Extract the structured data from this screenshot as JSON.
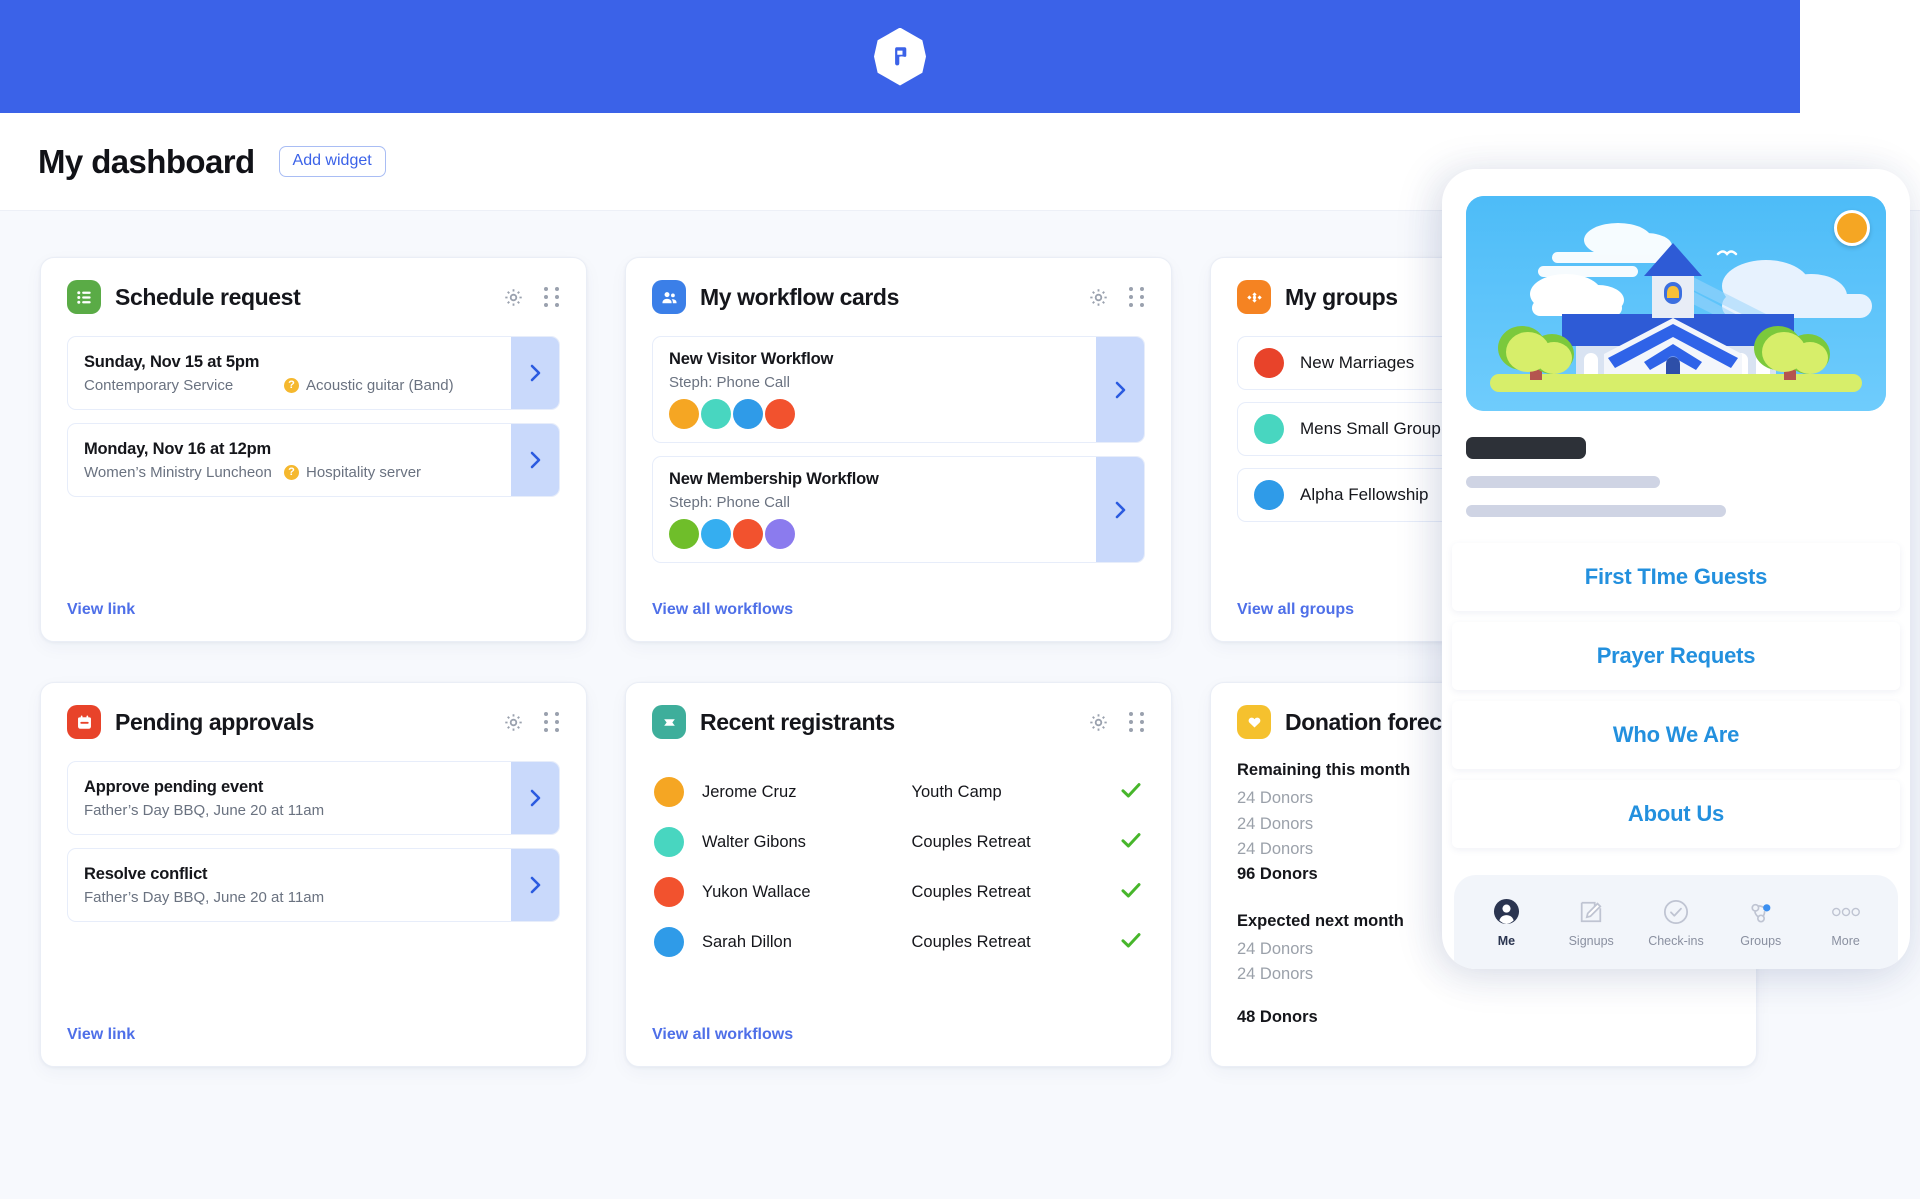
{
  "header": {
    "logo_name": "planning-center-logo",
    "bar_color": "#3B62E8"
  },
  "page": {
    "title": "My dashboard",
    "add_widget_label": "Add widget"
  },
  "widgets": [
    {
      "id": "schedule-request",
      "title": "Schedule request",
      "icon": "services-list-icon",
      "icon_color": "#5AAB46",
      "link_label": "View link",
      "items": [
        {
          "main": "Sunday, Nov 15 at 5pm",
          "sub_left": "Contemporary Service",
          "sub_right": "Acoustic guitar (Band)",
          "has_warning": true
        },
        {
          "main": "Monday, Nov 16 at 12pm",
          "sub_left": "Women’s Ministry Luncheon",
          "sub_right": "Hospitality server",
          "has_warning": true
        }
      ]
    },
    {
      "id": "my-workflow-cards",
      "title": "My workflow cards",
      "icon": "people-icon",
      "icon_color": "#3B7FE8",
      "link_label": "View all workflows",
      "items": [
        {
          "main": "New Visitor Workflow",
          "sub_left": "Steph: Phone Call",
          "avatars": [
            "#F5A623",
            "#48D6C0",
            "#2F9BE8",
            "#F2522E"
          ]
        },
        {
          "main": "New Membership Workflow",
          "sub_left": "Steph: Phone Call",
          "avatars": [
            "#6FBE2A",
            "#35AEF0",
            "#F2522E",
            "#8B7BEE"
          ]
        }
      ]
    },
    {
      "id": "my-groups",
      "title": "My groups",
      "icon": "groups-icon",
      "icon_color": "#F58322",
      "link_label": "View all groups",
      "groups": [
        {
          "name": "New Marriages",
          "avatar_color": "#E8432A"
        },
        {
          "name": "Mens Small Group",
          "avatar_color": "#48D6C0"
        },
        {
          "name": "Alpha Fellowship",
          "avatar_color": "#2F9BE8"
        }
      ]
    },
    {
      "id": "pending-approvals",
      "title": "Pending approvals",
      "icon": "calendar-icon",
      "icon_color": "#E8432A",
      "link_label": "View link",
      "items": [
        {
          "main": "Approve pending event",
          "sub_left": "Father’s Day BBQ, June 20 at 11am"
        },
        {
          "main": "Resolve conflict",
          "sub_left": "Father’s Day BBQ, June 20 at 11am"
        }
      ]
    },
    {
      "id": "recent-registrants",
      "title": "Recent registrants",
      "icon": "ticket-icon",
      "icon_color": "#3EAE9B",
      "link_label": "View all workflows",
      "registrants": [
        {
          "name": "Jerome Cruz",
          "event": "Youth Camp",
          "status": "check",
          "avatar_color": "#F5A623"
        },
        {
          "name": "Walter Gibons",
          "event": "Couples Retreat",
          "status": "check",
          "avatar_color": "#48D6C0"
        },
        {
          "name": "Yukon Wallace",
          "event": "Couples Retreat",
          "status": "check",
          "avatar_color": "#F2522E"
        },
        {
          "name": "Sarah Dillon",
          "event": "Couples Retreat",
          "status": "check",
          "avatar_color": "#2F9BE8"
        }
      ]
    },
    {
      "id": "donation-forecast",
      "title": "Donation forecast",
      "icon": "heart-icon",
      "icon_color": "#F5C12E",
      "sections": [
        {
          "heading": "Remaining this month",
          "lines": [
            "24 Donors",
            "24 Donors",
            "24 Donors"
          ],
          "total": "96 Donors"
        },
        {
          "heading": "Expected next month",
          "lines": [
            "24 Donors",
            "24 Donors"
          ],
          "total": "48 Donors"
        }
      ]
    }
  ],
  "phone": {
    "hero_alt": "church-illustration",
    "links": [
      "First TIme Guests",
      "Prayer Requets",
      "Who We Are",
      "About Us"
    ],
    "nav": [
      {
        "label": "Me",
        "icon": "person-icon",
        "active": true
      },
      {
        "label": "Signups",
        "icon": "pencil-square-icon",
        "active": false
      },
      {
        "label": "Check-ins",
        "icon": "check-circle-icon",
        "active": false
      },
      {
        "label": "Groups",
        "icon": "groups-node-icon",
        "active": false
      },
      {
        "label": "More",
        "icon": "ellipsis-icon",
        "active": false
      }
    ]
  },
  "icons": {
    "warning_glyph": "?",
    "chevron": "›"
  }
}
